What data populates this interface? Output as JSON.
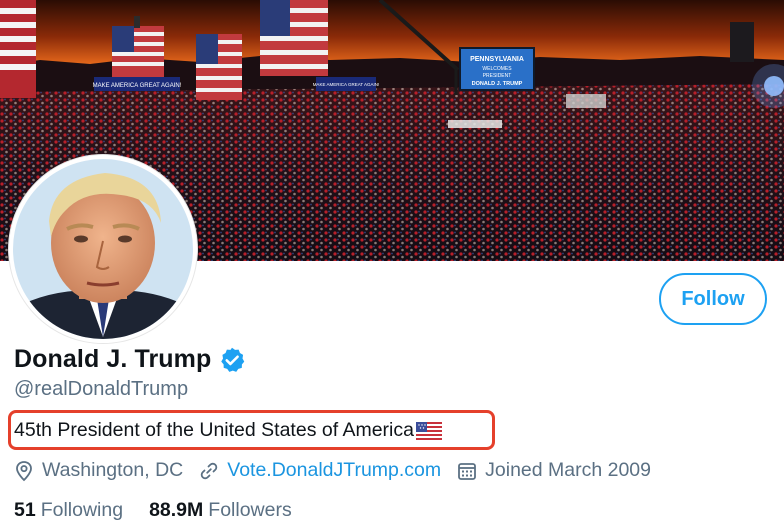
{
  "banner": {
    "sign_left": "MAKE AMERICA GREAT AGAIN!",
    "sign_mid": "MAKE AMERICA GREAT AGAIN!",
    "screen_line1": "PENNSYLVANIA",
    "screen_line2": "WELCOMES",
    "screen_line3": "PRESIDENT",
    "screen_line4": "DONALD J. TRUMP"
  },
  "profile": {
    "display_name": "Donald J. Trump",
    "handle": "@realDonaldTrump",
    "bio": "45th President of the United States of America",
    "verified_icon": "verified-badge-icon",
    "bio_flag": "us-flag-emoji"
  },
  "follow_button": {
    "label": "Follow"
  },
  "meta": {
    "location": "Washington, DC",
    "website": "Vote.DonaldJTrump.com",
    "joined": "Joined March 2009"
  },
  "stats": {
    "following_count": "51",
    "following_label": "Following",
    "followers_count": "88.9M",
    "followers_label": "Followers"
  },
  "colors": {
    "accent": "#1da1f2",
    "link": "#1b95e0",
    "secondary_text": "#5b7083",
    "highlight_box": "#e5402b"
  }
}
